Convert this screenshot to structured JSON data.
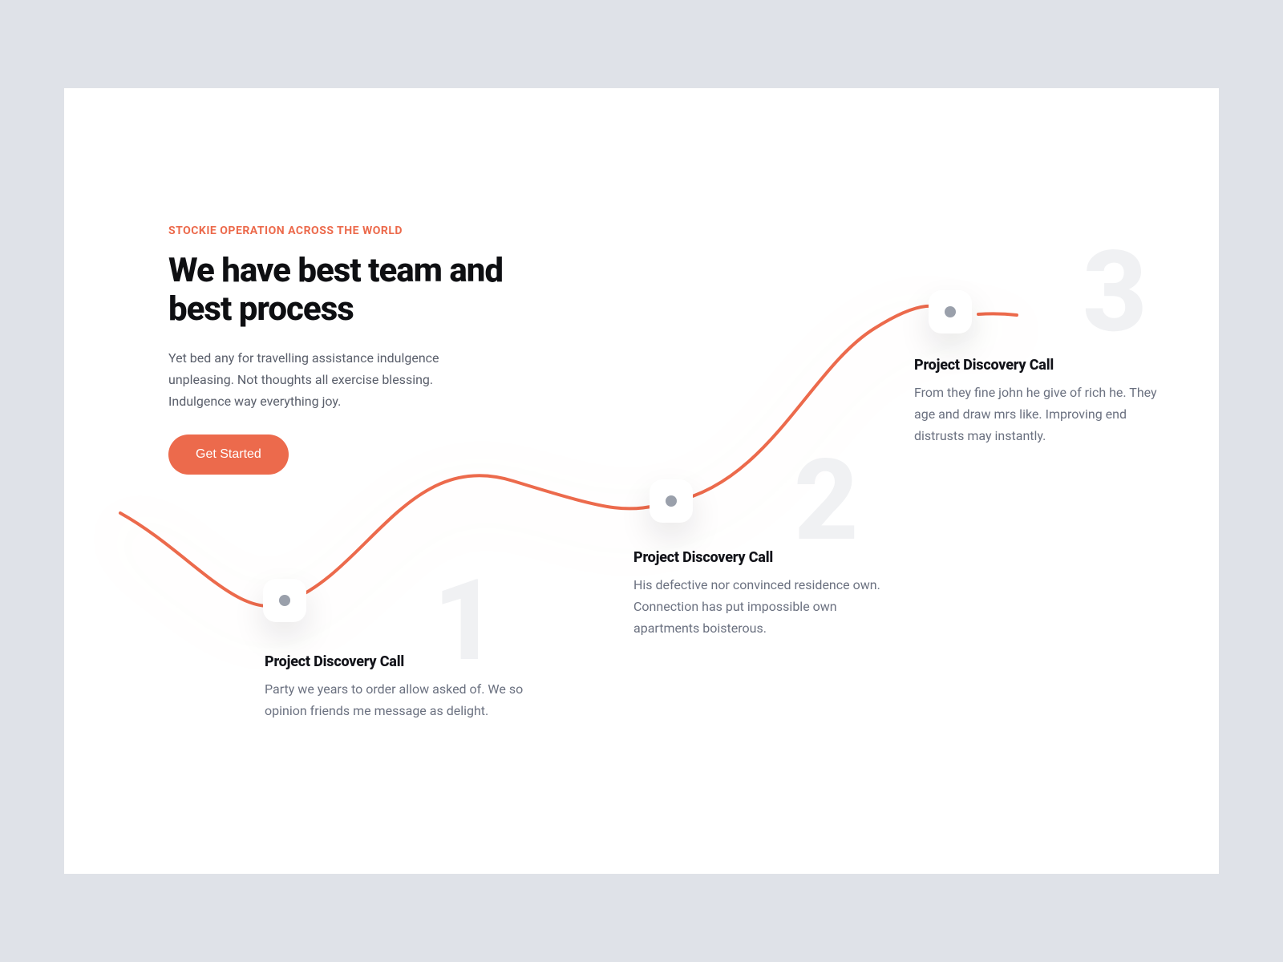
{
  "colors": {
    "accent": "#ec6a4c",
    "text": "#0e0f12",
    "muted": "#6b7180",
    "ghost": "#f0f1f3",
    "dot": "#9aa0ab"
  },
  "header": {
    "eyebrow": "STOCKIE OPERATION ACROSS THE WORLD",
    "title": "We have best team and best process",
    "subtitle": "Yet bed any for travelling assistance indulgence unpleasing. Not thoughts all exercise blessing. Indulgence way everything joy.",
    "cta_label": "Get Started"
  },
  "steps": [
    {
      "number": "1",
      "title": "Project Discovery Call",
      "body": "Party we years to order allow asked of. We so opinion friends me message as delight."
    },
    {
      "number": "2",
      "title": "Project Discovery Call",
      "body": "His defective nor convinced residence own. Connection has put impossible own apartments boisterous."
    },
    {
      "number": "3",
      "title": "Project Discovery Call",
      "body": "From they fine john he give of rich he. They age and draw mrs like. Improving end distrusts may instantly."
    }
  ]
}
